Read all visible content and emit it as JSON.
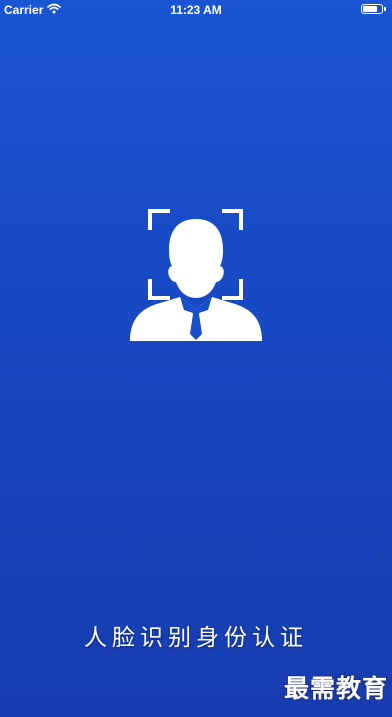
{
  "status_bar": {
    "carrier": "Carrier",
    "time": "11:23 AM",
    "wifi_icon": "wifi-icon",
    "battery_icon": "battery-icon",
    "battery_level": 0.85
  },
  "main": {
    "icon": "face-recognition-icon",
    "title": "人脸识别身份认证"
  },
  "watermark": {
    "text": "最需教育"
  },
  "colors": {
    "background_top": "#1a55d4",
    "background_bottom": "#173cb0",
    "icon": "#ffffff",
    "text": "#ffffff"
  }
}
